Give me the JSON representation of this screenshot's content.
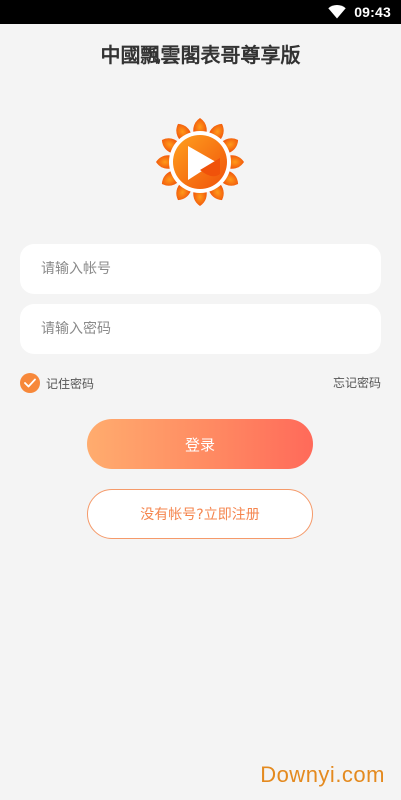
{
  "status_bar": {
    "time": "09:43",
    "icons": [
      "wifi-icon"
    ]
  },
  "header": {
    "title": "中國飄雲閣表哥尊享版"
  },
  "logo": {
    "icon": "sunflower-play-logo"
  },
  "login_form": {
    "account_placeholder": "请输入帐号",
    "account_value": "",
    "password_placeholder": "请输入密码",
    "password_value": "",
    "remember_label": "记住密码",
    "remember_checked": true,
    "forgot_label": "忘记密码",
    "login_label": "登录",
    "register_label": "没有帐号?立即注册"
  },
  "watermark": {
    "text": "Downyi.com"
  },
  "colors": {
    "accent": "#f7883a",
    "background": "#f4f4f4",
    "button_gradient_start": "#ffac6e",
    "button_gradient_end": "#ff6a5a",
    "register_border": "#f59a6a",
    "watermark": "#e48a1f"
  }
}
